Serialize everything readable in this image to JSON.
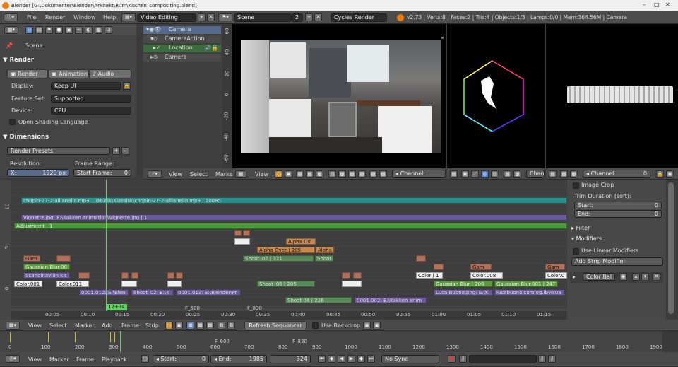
{
  "window": {
    "title": "Blender [G:\\Dokumenter\\Blender\\Arkitekt\\Rum\\Kitchen_compositing.blend]"
  },
  "menu": {
    "items": [
      "File",
      "Render",
      "Window",
      "Help"
    ],
    "layout": "Video Editing",
    "scene": "Scene",
    "scene_users": "2",
    "engine": "Cycles Render",
    "stats": "v2.73 | Verts:8 | Faces:2 | Tris:4 | Objects:1/3 | Lamps:0/0 | Mem:364.56M | Camera"
  },
  "properties": {
    "context": "Scene",
    "render_title": "Render",
    "render_btn": "Render",
    "animation_btn": "Animation",
    "audio_btn": "Audio",
    "display_label": "Display:",
    "display_val": "Keep UI",
    "feature_label": "Feature Set:",
    "feature_val": "Supported",
    "device_label": "Device:",
    "device_val": "CPU",
    "osl": "Open Shading Language",
    "dimensions_title": "Dimensions",
    "presets": "Render Presets",
    "resolution_label": "Resolution:",
    "frame_range_label": "Frame Range:",
    "res_x": "X:",
    "res_x_val": "1920 px",
    "start_frame": "Start Frame:",
    "start_frame_val": "0"
  },
  "outliner": {
    "items": [
      "Camera",
      "CameraAction",
      "Location",
      "Camera"
    ],
    "ruler": [
      "60",
      "40",
      "20",
      "0",
      "-20",
      "-40",
      "-60"
    ]
  },
  "graph_header": {
    "view": "View",
    "select": "Select",
    "marker": "Marke"
  },
  "preview_header": {
    "view": "View",
    "channel_label": "Channel:",
    "channel_val": "0",
    "chan_short": "Chan"
  },
  "sequencer": {
    "row_labels": [
      "10",
      "5",
      "0"
    ],
    "strips": [
      "chopin-27-2-allianello.mp3:...\\Musik\\Klassisk\\chopin-27-2-allianello.mp3 | 10085",
      "Vignette.jpg: E:\\Kakken animation\\Vignette.jpg | 1",
      "Adjustment | 1",
      "Alpha Ov",
      "Alpha Over | 205",
      "Alpha",
      "Shoot_07 | 321",
      "Shoot",
      "Gam",
      "Gaussian Blur.00",
      "Scandinavian kit",
      "Color.001",
      "Color.011",
      "Gam",
      "Gam",
      "Color | 1",
      "Color.008",
      "Color.0",
      "Shoot_06 | 205",
      "Gaussian Blur | 206",
      "Gaussian Blur.001 | 247",
      "0001.012: E:\\Blen",
      "Shoot_02: E:\\K",
      "0001.013: E:\\Blender\\Pr",
      "Luca Buono.png: E:\\K",
      "lucabuono.com.og.lbvisua",
      "Shoot 04 | 226",
      "0001.002: E:\\Kakken anim"
    ],
    "current_frame": "12+24",
    "markers": [
      "F_600",
      "F_830"
    ],
    "ticks": [
      "00:05",
      "00:10",
      "00:15",
      "00:20",
      "00:25",
      "00:30",
      "00:35",
      "00:40",
      "00:45",
      "00:50",
      "00:55",
      "01:00",
      "01:05",
      "01:10",
      "01:15"
    ]
  },
  "strip_panel": {
    "image_crop": "Image Crop",
    "trim": "Trim Duration (soft):",
    "start": "Start:",
    "start_val": "0",
    "end": "End:",
    "end_val": "0",
    "filter": "Filter",
    "modifiers": "Modifiers",
    "use_linear": "Use Linear Modifiers",
    "add_mod": "Add Strip Modifier",
    "color_bal": "Color Bal"
  },
  "seq_header": {
    "view": "View",
    "select": "Select",
    "marker": "Marker",
    "add": "Add",
    "frame": "Frame",
    "strip": "Strip",
    "refresh": "Refresh Sequencer",
    "backdrop": "Use Backdrop"
  },
  "timeline": {
    "ticks": [
      "0",
      "100",
      "200",
      "300",
      "400",
      "500",
      "600",
      "700",
      "800",
      "900",
      "1000",
      "1100",
      "1200",
      "1300",
      "1400",
      "1500",
      "1600",
      "1700",
      "1800",
      "1900"
    ],
    "markers": [
      "F_600",
      "F_830"
    ],
    "view": "View",
    "marker": "Marker",
    "frame": "Frame",
    "playback": "Playback",
    "start_label": "Start:",
    "start_val": "0",
    "end_label": "End:",
    "end_val": "1985",
    "current": "324",
    "sync": "No Sync"
  }
}
